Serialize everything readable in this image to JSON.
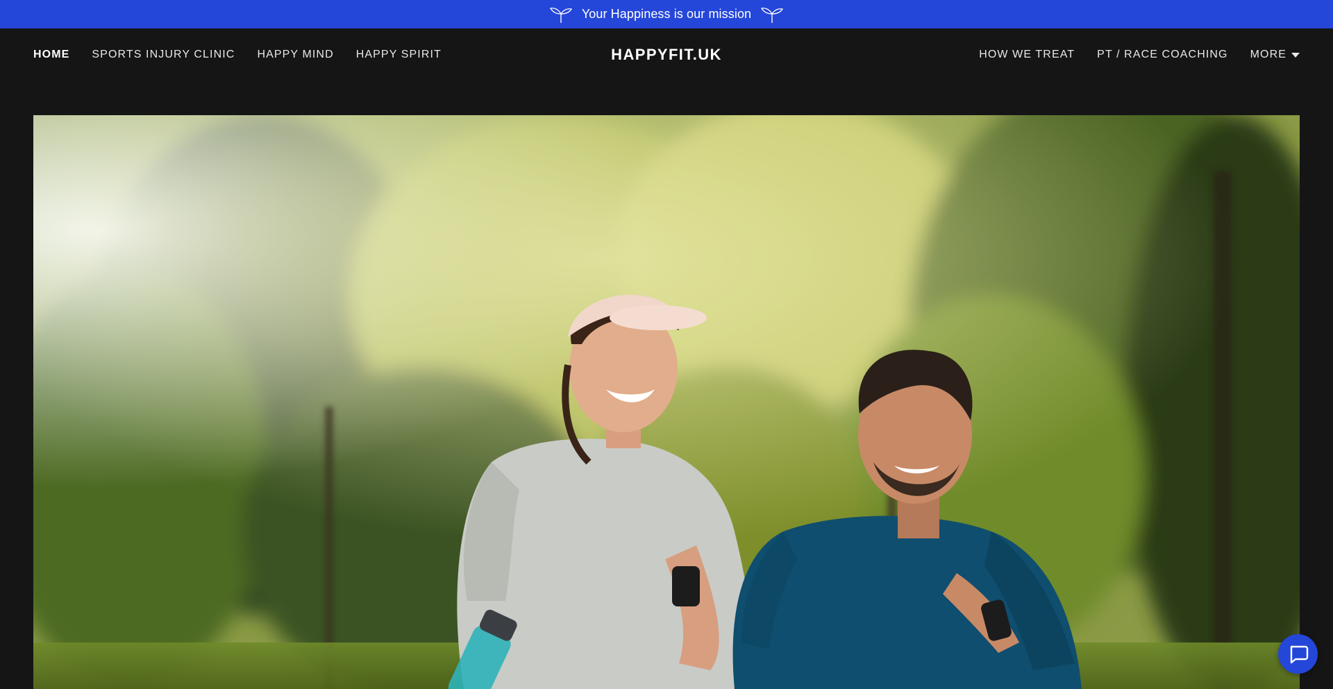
{
  "announcement": {
    "text": "Your Happiness is our mission",
    "icon_left": "sprout-icon",
    "icon_right": "sprout-icon",
    "background": "#2446d9"
  },
  "header": {
    "brand": "HAPPYFIT.UK",
    "nav_left": [
      {
        "label": "HOME",
        "active": true
      },
      {
        "label": "SPORTS INJURY CLINIC",
        "active": false
      },
      {
        "label": "HAPPY MIND",
        "active": false
      },
      {
        "label": "HAPPY SPIRIT",
        "active": false
      }
    ],
    "nav_right": [
      {
        "label": "HOW WE TREAT"
      },
      {
        "label": "PT / RACE COACHING"
      }
    ],
    "more_label": "MORE",
    "more_icon": "caret-down-icon"
  },
  "hero": {
    "image": "hero-image-two-runners-in-park"
  },
  "chat": {
    "icon": "chat-bubble-icon",
    "color": "#2446d9"
  }
}
